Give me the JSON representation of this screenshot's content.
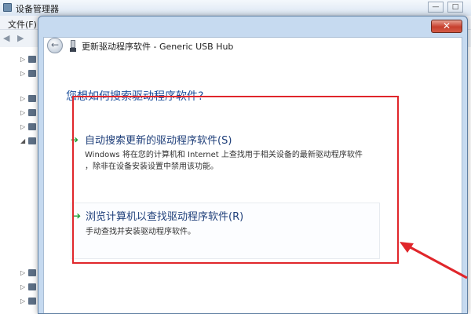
{
  "background_window": {
    "title": "设备管理器",
    "menu_file": "文件(F)",
    "min_glyph": "—",
    "max_glyph": "□"
  },
  "dialog": {
    "close_glyph": "✕",
    "back_glyph": "←",
    "title": "更新驱动程序软件 - Generic USB Hub",
    "question": "您想如何搜索驱动程序软件?",
    "options": [
      {
        "title": "自动搜索更新的驱动程序软件(S)",
        "desc_line1": "Windows 将在您的计算机和 Internet 上查找用于相关设备的最新驱动程序软件",
        "desc_line2": "，除非在设备安装设置中禁用该功能。"
      },
      {
        "title": "浏览计算机以查找驱动程序软件(R)",
        "desc_line1": "手动查找并安装驱动程序软件。"
      }
    ],
    "arrow_glyph": "➔"
  },
  "colors": {
    "annotation_red": "#e0262b",
    "link_blue": "#1c4f9c",
    "arrow_green": "#1f9d35"
  },
  "icons": [
    "device-manager-icon",
    "back-arrow-icon",
    "usb-device-icon",
    "green-arrow-icon",
    "close-icon"
  ]
}
